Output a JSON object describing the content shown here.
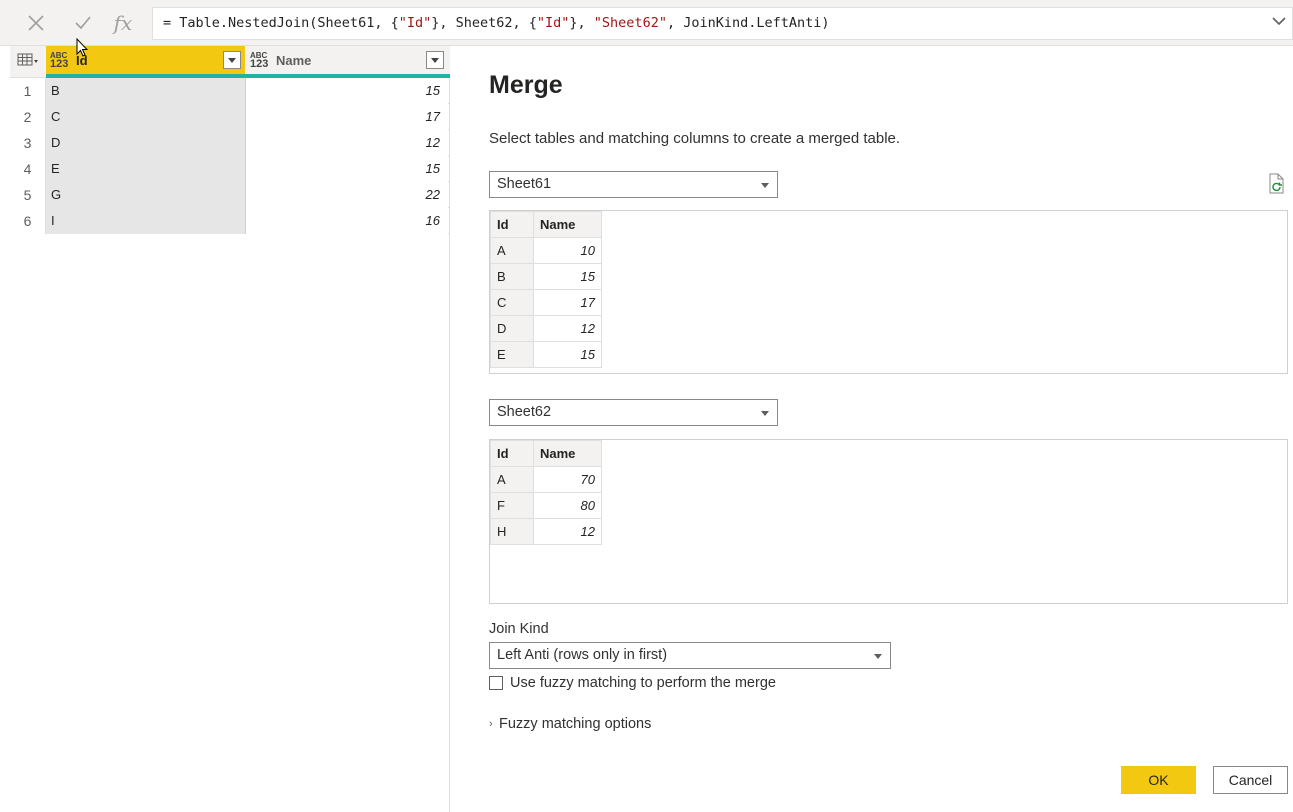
{
  "formula_bar": {
    "cancel_icon": "close-icon",
    "confirm_icon": "check-icon",
    "fx_label": "fx",
    "formula_parts": {
      "p1": "= Table.NestedJoin(Sheet61, {",
      "s1": "\"Id\"",
      "p2": "}, Sheet62, {",
      "s2": "\"Id\"",
      "p3": "}, ",
      "s3": "\"Sheet62\"",
      "p4": ", JoinKind.LeftAnti)"
    }
  },
  "grid": {
    "type_abc": "ABC",
    "type_123": "123",
    "columns": [
      "Id",
      "Name"
    ],
    "rows": [
      {
        "num": "1",
        "id": "B",
        "name": "15"
      },
      {
        "num": "2",
        "id": "C",
        "name": "17"
      },
      {
        "num": "3",
        "id": "D",
        "name": "12"
      },
      {
        "num": "4",
        "id": "E",
        "name": "15"
      },
      {
        "num": "5",
        "id": "G",
        "name": "22"
      },
      {
        "num": "6",
        "id": "I",
        "name": "16"
      }
    ],
    "accent_color": "#f2c811"
  },
  "merge": {
    "title": "Merge",
    "subtitle": "Select tables and matching columns to create a merged table.",
    "table1": {
      "selected": "Sheet61",
      "headers": [
        "Id",
        "Name"
      ],
      "rows": [
        {
          "id": "A",
          "name": "10"
        },
        {
          "id": "B",
          "name": "15"
        },
        {
          "id": "C",
          "name": "17"
        },
        {
          "id": "D",
          "name": "12"
        },
        {
          "id": "E",
          "name": "15"
        }
      ]
    },
    "table2": {
      "selected": "Sheet62",
      "headers": [
        "Id",
        "Name"
      ],
      "rows": [
        {
          "id": "A",
          "name": "70"
        },
        {
          "id": "F",
          "name": "80"
        },
        {
          "id": "H",
          "name": "12"
        }
      ]
    },
    "join_kind_label": "Join Kind",
    "join_kind_value": "Left Anti (rows only in first)",
    "fuzzy_label": "Use fuzzy matching to perform the merge",
    "fuzzy_checked": false,
    "fuzzy_options_label": "Fuzzy matching options",
    "ok_label": "OK",
    "cancel_label": "Cancel",
    "ok_color": "#f2c811"
  }
}
